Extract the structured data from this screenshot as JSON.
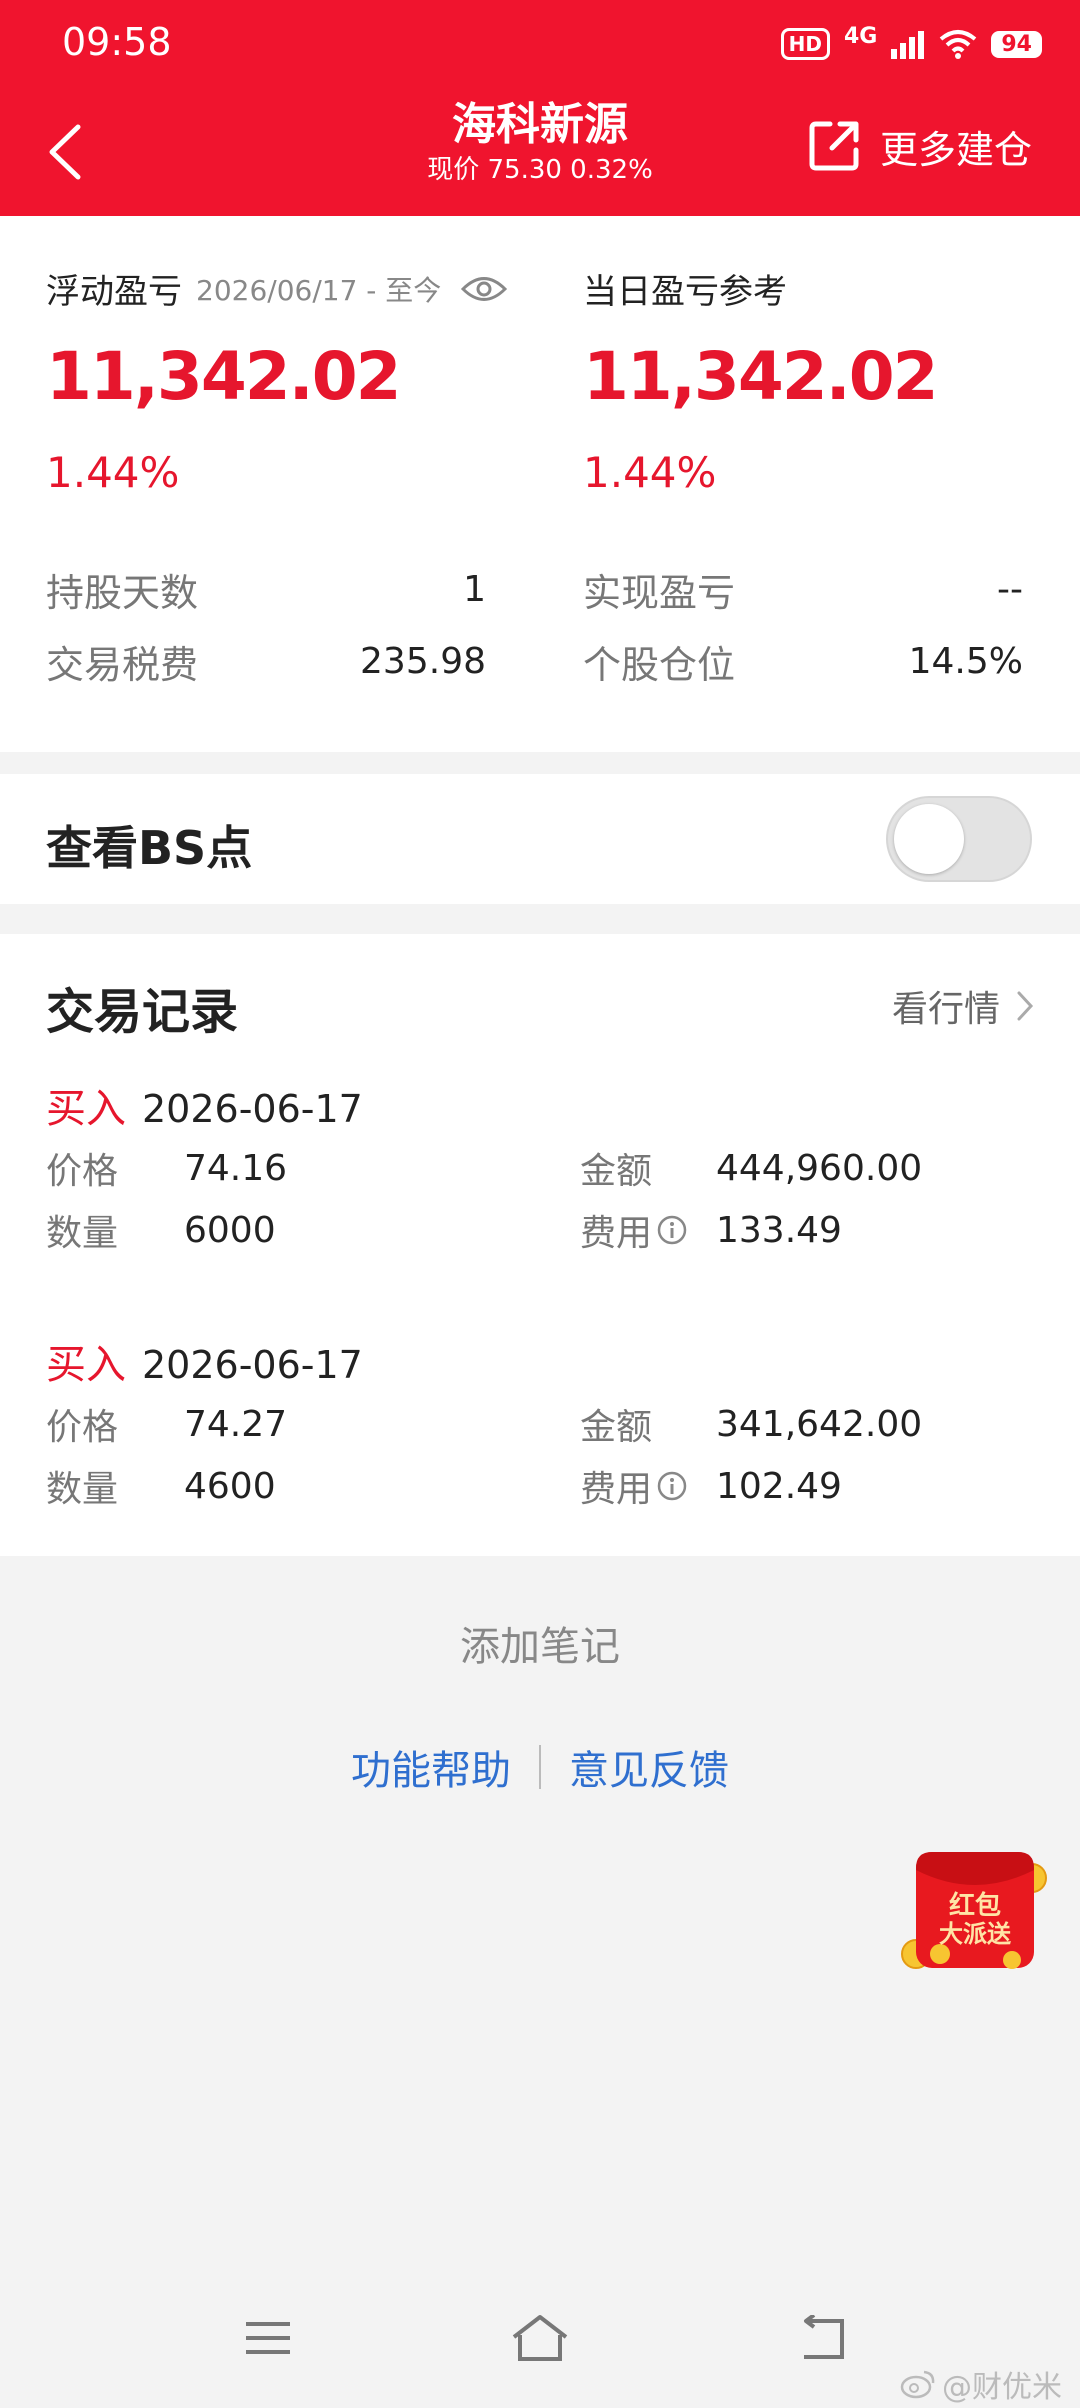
{
  "status_bar": {
    "time": "09:58",
    "hd": "HD",
    "network": "4G",
    "battery": "94"
  },
  "header": {
    "title": "海科新源",
    "price_line": "现价 75.30 0.32%",
    "more_label": "更多建仓"
  },
  "summary": {
    "float_label": "浮动盈亏",
    "float_date": "2026/06/17 - 至今",
    "float_value": "11,342.02",
    "float_pct": "1.44%",
    "day_label": "当日盈亏参考",
    "day_value": "11,342.02",
    "day_pct": "1.44%",
    "stats": [
      {
        "label": "持股天数",
        "value": "1"
      },
      {
        "label": "交易税费",
        "value": "235.98"
      },
      {
        "label": "实现盈亏",
        "value": "--"
      },
      {
        "label": "个股仓位",
        "value": "14.5%"
      }
    ]
  },
  "bs": {
    "label": "查看BS点",
    "enabled": false
  },
  "records": {
    "title": "交易记录",
    "view_market": "看行情",
    "labels": {
      "price": "价格",
      "qty": "数量",
      "amount": "金额",
      "fee": "费用"
    },
    "trades": [
      {
        "type": "买入",
        "date": "2026-06-17",
        "price": "74.16",
        "qty": "6000",
        "amount": "444,960.00",
        "fee": "133.49"
      },
      {
        "type": "买入",
        "date": "2026-06-17",
        "price": "74.27",
        "qty": "4600",
        "amount": "341,642.00",
        "fee": "102.49"
      }
    ]
  },
  "footer": {
    "add_note": "添加笔记",
    "help": "功能帮助",
    "feedback": "意见反馈"
  },
  "promo": {
    "line1": "红包",
    "line2": "大派送"
  },
  "watermark": "@财优米",
  "colors": {
    "brand_red": "#f0142e",
    "profit_red": "#e6162d",
    "link_blue": "#2f6fcf"
  }
}
